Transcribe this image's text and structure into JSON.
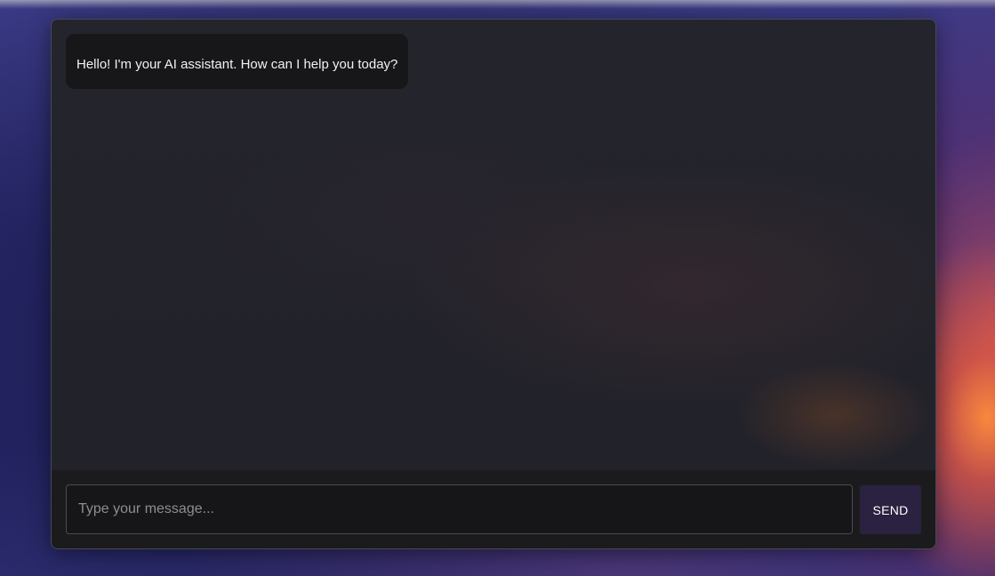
{
  "chat": {
    "messages": [
      {
        "role": "assistant",
        "text": "Hello! I'm your AI assistant. How can I help you today?"
      }
    ]
  },
  "composer": {
    "placeholder": "Type your message...",
    "value": "",
    "send_label": "SEND"
  },
  "colors": {
    "send_button": "#2a2240",
    "bubble_background": "#171719",
    "input_bar_background": "#1b1b1d"
  }
}
